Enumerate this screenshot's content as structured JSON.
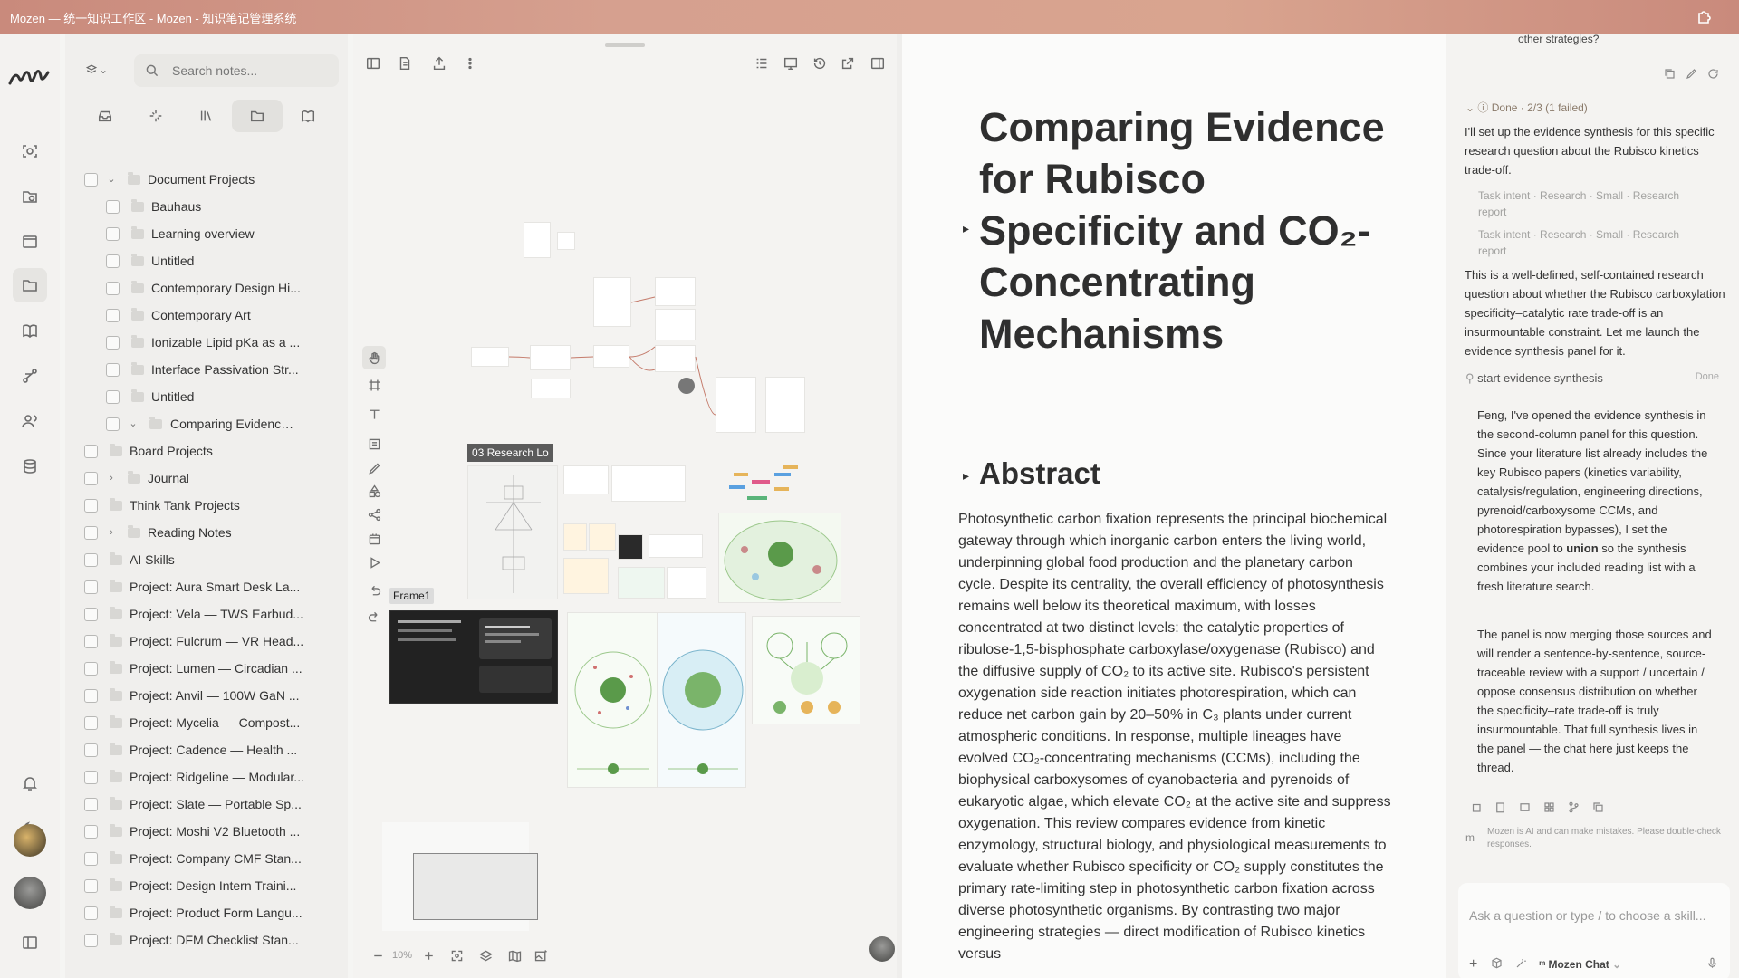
{
  "window": {
    "title": "Mozen — 统一知识工作区 - Mozen - 知识笔记管理系统"
  },
  "sidebar": {
    "search_placeholder": "Search notes...",
    "tree": [
      {
        "label": "Document Projects",
        "expanded": true
      },
      {
        "label": "Bauhaus"
      },
      {
        "label": "Learning overview"
      },
      {
        "label": "Untitled"
      },
      {
        "label": "Contemporary Design Hi..."
      },
      {
        "label": "Contemporary Art"
      },
      {
        "label": "Ionizable Lipid pKa as a ..."
      },
      {
        "label": "Interface Passivation Str..."
      },
      {
        "label": "Untitled"
      },
      {
        "label": "Comparing Evidence ...",
        "expanded": true
      },
      {
        "label": "Board Projects"
      },
      {
        "label": "Journal",
        "expandable": true
      },
      {
        "label": "Think Tank Projects"
      },
      {
        "label": "Reading Notes",
        "expandable": true
      },
      {
        "label": "AI Skills"
      },
      {
        "label": "Project: Aura Smart Desk La..."
      },
      {
        "label": "Project: Vela — TWS Earbud..."
      },
      {
        "label": "Project: Fulcrum — VR Head..."
      },
      {
        "label": "Project: Lumen — Circadian ..."
      },
      {
        "label": "Project: Anvil — 100W GaN ..."
      },
      {
        "label": "Project: Mycelia — Compost..."
      },
      {
        "label": "Project: Cadence — Health ..."
      },
      {
        "label": "Project: Ridgeline — Modular..."
      },
      {
        "label": "Project: Slate — Portable Sp..."
      },
      {
        "label": "Project: Moshi V2 Bluetooth ..."
      },
      {
        "label": "Project: Company CMF Stan..."
      },
      {
        "label": "Project: Design Intern Traini..."
      },
      {
        "label": "Project: Product Form Langu..."
      },
      {
        "label": "Project: DFM Checklist Stan..."
      }
    ]
  },
  "canvas": {
    "frame_label": "Frame1",
    "research_label": "03 Research Lo",
    "zoom": "10%"
  },
  "document": {
    "title": "Comparing Evidence for Rubisco Specificity and CO₂-Concentrating Mechanisms",
    "abstract_heading": "Abstract",
    "abstract_text": "Photosynthetic carbon fixation represents the principal biochemical gateway through which inorganic carbon enters the living world, underpinning global food production and the planetary carbon cycle. Despite its centrality, the overall efficiency of photosynthesis remains well below its theoretical maximum, with losses concentrated at two distinct levels: the catalytic properties of ribulose-1,5-bisphosphate carboxylase/oxygenase (Rubisco) and the diffusive supply of CO₂ to its active site. Rubisco's persistent oxygenation side reaction initiates photorespiration, which can reduce net carbon gain by 20–50% in C₃ plants under current atmospheric conditions. In response, multiple lineages have evolved CO₂-concentrating mechanisms (CCMs), including the biophysical carboxysomes of cyanobacteria and pyrenoids of eukaryotic algae, which elevate CO₂ at the active site and suppress oxygenation. This review compares evidence from kinetic enzymology, structural biology, and physiological measurements to evaluate whether Rubisco specificity or CO₂ supply constitutes the primary rate-limiting step in photosynthetic carbon fixation across diverse photosynthetic organisms. By contrasting two major engineering strategies — direct modification of Rubisco kinetics versus"
  },
  "chat": {
    "top_fragment": "other strategies?",
    "status": "Done · 2/3 (1 failed)",
    "msg1": "I'll set up the evidence synthesis for this specific research question about the Rubisco kinetics trade-off.",
    "intent1": "Task intent · Research · Small · Research report",
    "intent2": "Task intent · Research · Small · Research report",
    "msg2": "This is a well-defined, self-contained research question about whether the Rubisco carboxylation specificity–catalytic rate trade-off is an insurmountable constraint. Let me launch the evidence synthesis panel for it.",
    "tool_label": "start evidence synthesis",
    "tool_status": "Done",
    "reply1_a": "Feng, I've opened the evidence synthesis in the second-column panel for this question. Since your literature list already includes the key Rubisco papers (kinetics variability, catalysis/regulation, engineering directions, pyrenoid/carboxysome CCMs, and photorespiration bypasses), I set the evidence pool to ",
    "reply1_bold": "union",
    "reply1_b": " so the synthesis combines your included reading list with a fresh literature search.",
    "reply2": "The panel is now merging those sources and will render a sentence-by-sentence, source-traceable review with a support / uncertain / oppose consensus distribution on whether the specificity–rate trade-off is truly insurmountable. That full synthesis lives in the panel — the chat here just keeps the thread.",
    "disclaimer": "Mozen is AI and can make mistakes. Please double-check responses.",
    "input_placeholder": "Ask a question or type / to choose a skill...",
    "model": "Mozen Chat"
  }
}
